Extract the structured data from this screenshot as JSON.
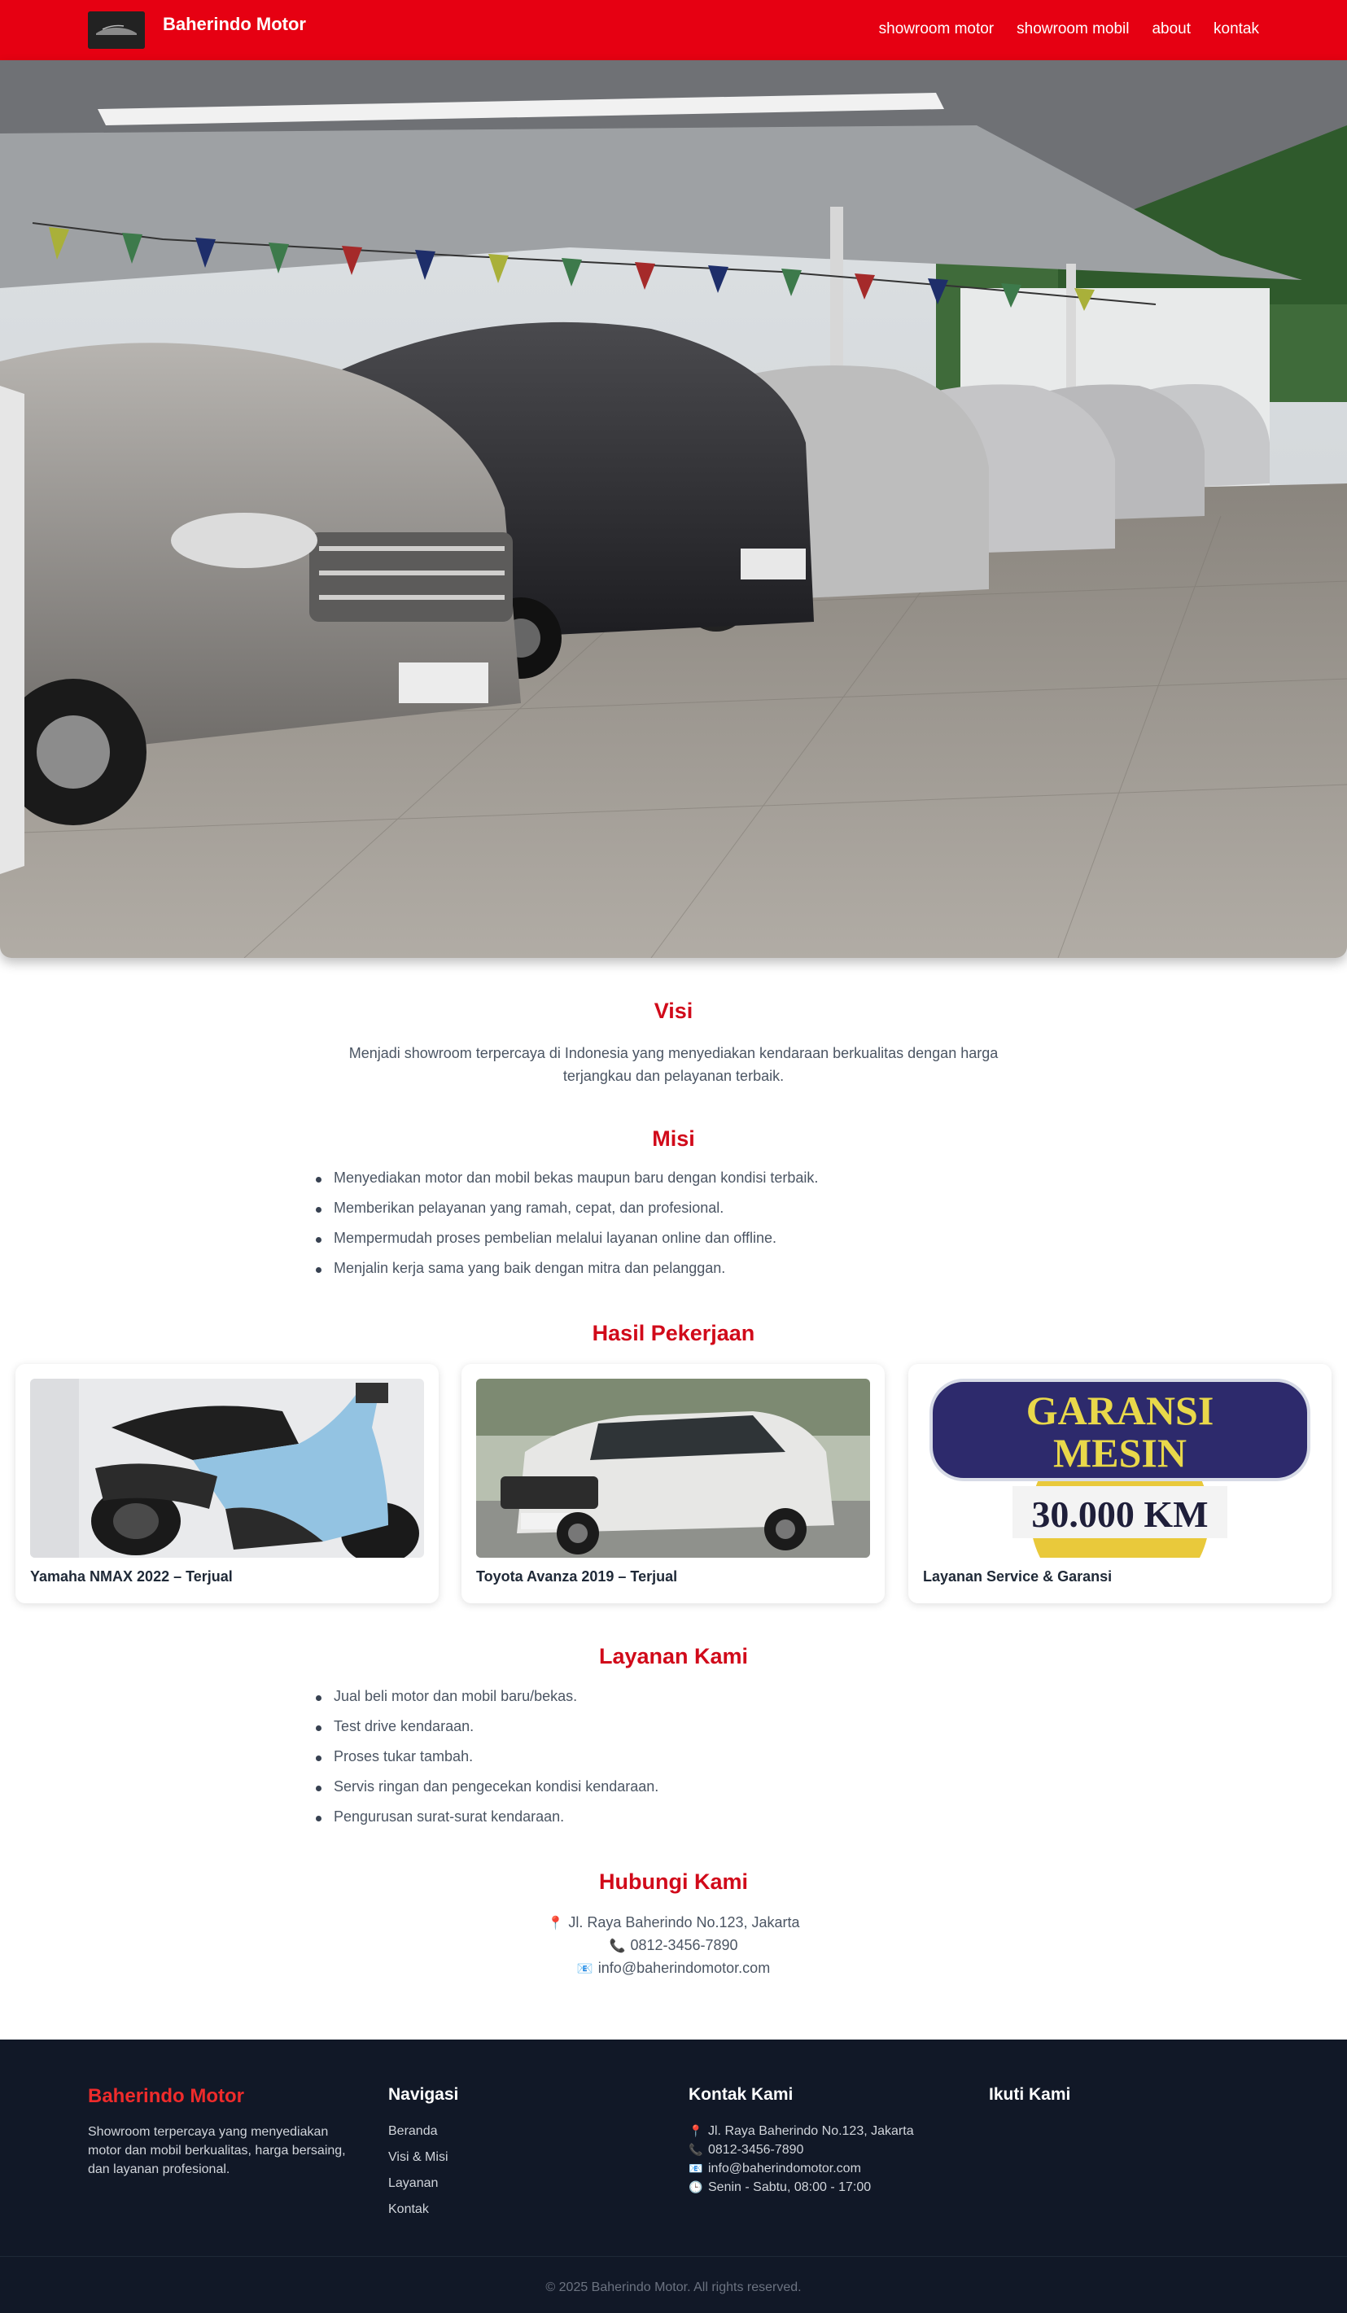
{
  "navbar": {
    "brand": "Baherindo Motor",
    "links": [
      "showroom motor",
      "showroom mobil",
      "about",
      "kontak"
    ],
    "bg_color": "#e60012"
  },
  "hero": {
    "image": "car-showroom-photo"
  },
  "visi": {
    "title": "Visi",
    "text": "Menjadi showroom terpercaya di Indonesia yang menyediakan kendaraan berkualitas dengan harga terjangkau dan pelayanan terbaik."
  },
  "misi": {
    "title": "Misi",
    "items": [
      "Menyediakan motor dan mobil bekas maupun baru dengan kondisi terbaik.",
      "Memberikan pelayanan yang ramah, cepat, dan profesional.",
      "Mempermudah proses pembelian melalui layanan online dan offline.",
      "Menjalin kerja sama yang baik dengan mitra dan pelanggan."
    ]
  },
  "hasil": {
    "title": "Hasil Pekerjaan",
    "cards": [
      {
        "caption": "Yamaha NMAX 2022 – Terjual"
      },
      {
        "caption": "Toyota Avanza 2019 – Terjual"
      },
      {
        "caption": "Layanan Service & Garansi",
        "badge_lines": [
          "GARANSI",
          "MESIN",
          "30.000 KM"
        ]
      }
    ]
  },
  "layanan": {
    "title": "Layanan Kami",
    "items": [
      "Jual beli motor dan mobil baru/bekas.",
      "Test drive kendaraan.",
      "Proses tukar tambah.",
      "Servis ringan dan pengecekan kondisi kendaraan.",
      "Pengurusan surat-surat kendaraan."
    ]
  },
  "hubungi": {
    "title": "Hubungi Kami",
    "address": "Jl. Raya Baherindo No.123, Jakarta",
    "phone": "0812-3456-7890",
    "email": "info@baherindomotor.com",
    "icons": [
      "pin-icon",
      "phone-icon",
      "mail-icon"
    ]
  },
  "footer": {
    "brand": "Baherindo Motor",
    "description": "Showroom terpercaya yang menyediakan motor dan mobil berkualitas, harga bersaing, dan layanan profesional.",
    "nav_title": "Navigasi",
    "nav_links": [
      "Beranda",
      "Visi & Misi",
      "Layanan",
      "Kontak"
    ],
    "contact_title": "Kontak Kami",
    "contact": {
      "address": "Jl. Raya Baherindo No.123, Jakarta",
      "phone": "0812-3456-7890",
      "email": "info@baherindomotor.com",
      "hours": "Senin - Sabtu, 08:00 - 17:00"
    },
    "follow_title": "Ikuti Kami",
    "copyright": "© 2025 Baherindo Motor. All rights reserved.",
    "bg_color": "#111827",
    "accent": "#ef2b2b"
  }
}
